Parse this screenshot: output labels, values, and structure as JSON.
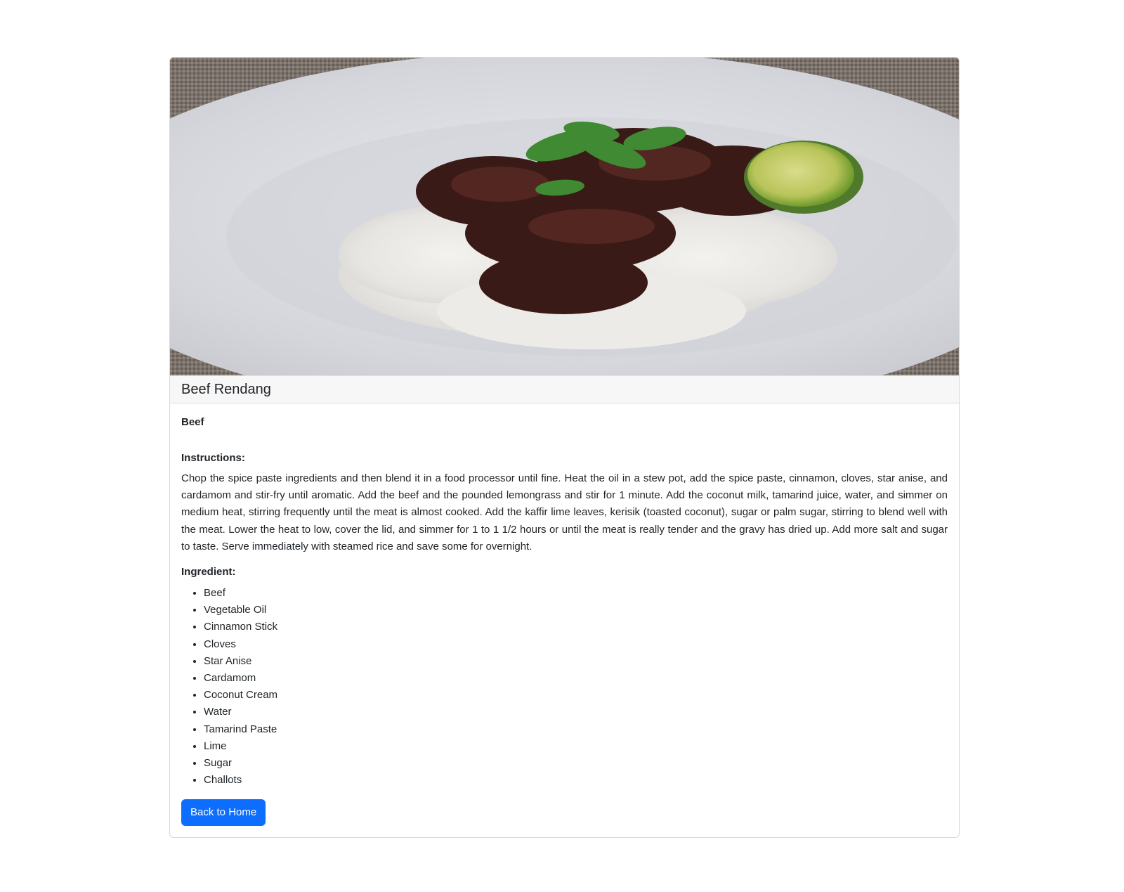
{
  "recipe": {
    "image_alt": "Beef Rendang",
    "title": "Beef Rendang",
    "category": "Beef",
    "instructions_label": "Instructions:",
    "instructions": "Chop the spice paste ingredients and then blend it in a food processor until fine. Heat the oil in a stew pot, add the spice paste, cinnamon, cloves, star anise, and cardamom and stir-fry until aromatic. Add the beef and the pounded lemongrass and stir for 1 minute. Add the coconut milk, tamarind juice, water, and simmer on medium heat, stirring frequently until the meat is almost cooked. Add the kaffir lime leaves, kerisik (toasted coconut), sugar or palm sugar, stirring to blend well with the meat. Lower the heat to low, cover the lid, and simmer for 1 to 1 1/2 hours or until the meat is really tender and the gravy has dried up. Add more salt and sugar to taste. Serve immediately with steamed rice and save some for overnight.",
    "ingredients_label": "Ingredient:",
    "ingredients": [
      "Beef",
      "Vegetable Oil",
      "Cinnamon Stick",
      "Cloves",
      "Star Anise",
      "Cardamom",
      "Coconut Cream",
      "Water",
      "Tamarind Paste",
      "Lime",
      "Sugar",
      "Challots"
    ]
  },
  "actions": {
    "back_label": "Back to Home"
  },
  "colors": {
    "primary_button": "#0d6efd",
    "header_bg": "#f7f7f7",
    "text": "#212529"
  }
}
